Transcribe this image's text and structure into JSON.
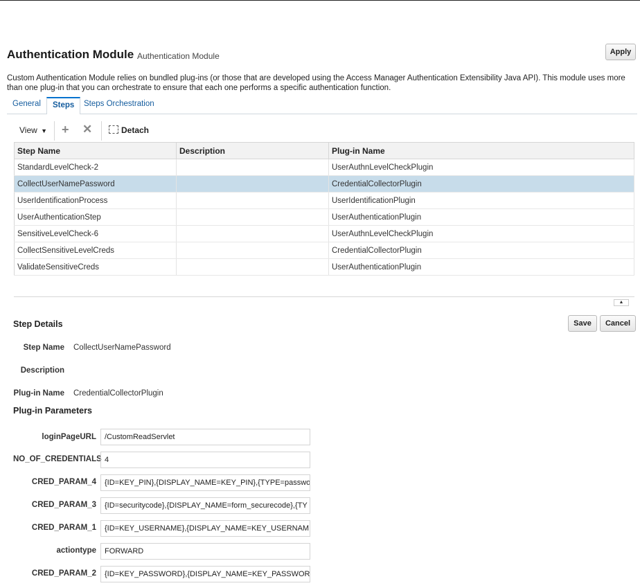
{
  "header": {
    "title": "Authentication Module",
    "subtitle": "Authentication Module",
    "apply_label": "Apply",
    "description": "Custom Authentication Module relies on bundled plug-ins (or those that are developed using the Access Manager Authentication Extensibility Java API). This module uses more than one plug-in that you can orchestrate to ensure that each one performs a specific authentication function."
  },
  "tabs": [
    {
      "label": "General"
    },
    {
      "label": "Steps"
    },
    {
      "label": "Steps Orchestration"
    }
  ],
  "toolbar": {
    "view_label": "View",
    "detach_label": "Detach"
  },
  "table": {
    "columns": [
      "Step Name",
      "Description",
      "Plug-in Name"
    ],
    "rows": [
      {
        "step": "StandardLevelCheck-2",
        "desc": "",
        "plugin": "UserAuthnLevelCheckPlugin"
      },
      {
        "step": "CollectUserNamePassword",
        "desc": "",
        "plugin": "CredentialCollectorPlugin"
      },
      {
        "step": "UserIdentificationProcess",
        "desc": "",
        "plugin": "UserIdentificationPlugin"
      },
      {
        "step": "UserAuthenticationStep",
        "desc": "",
        "plugin": "UserAuthenticationPlugin"
      },
      {
        "step": "SensitiveLevelCheck-6",
        "desc": "",
        "plugin": "UserAuthnLevelCheckPlugin"
      },
      {
        "step": "CollectSensitiveLevelCreds",
        "desc": "",
        "plugin": "CredentialCollectorPlugin"
      },
      {
        "step": "ValidateSensitiveCreds",
        "desc": "",
        "plugin": "UserAuthenticationPlugin"
      }
    ]
  },
  "step_details": {
    "heading": "Step Details",
    "save_label": "Save",
    "cancel_label": "Cancel",
    "step_name_label": "Step Name",
    "step_name_value": "CollectUserNamePassword",
    "description_label": "Description",
    "description_value": "",
    "plugin_name_label": "Plug-in Name",
    "plugin_name_value": "CredentialCollectorPlugin"
  },
  "plugin_params": {
    "heading": "Plug-in Parameters",
    "params": [
      {
        "label": "loginPageURL",
        "value": "/CustomReadServlet"
      },
      {
        "label": "NO_OF_CREDENTIALS",
        "value": "4"
      },
      {
        "label": "CRED_PARAM_4",
        "value": "{ID=KEY_PIN},{DISPLAY_NAME=KEY_PIN},{TYPE=passwo"
      },
      {
        "label": "CRED_PARAM_3",
        "value": "{ID=securitycode},{DISPLAY_NAME=form_securecode},{TY"
      },
      {
        "label": "CRED_PARAM_1",
        "value": "{ID=KEY_USERNAME},{DISPLAY_NAME=KEY_USERNAME"
      },
      {
        "label": "actiontype",
        "value": "FORWARD"
      },
      {
        "label": "CRED_PARAM_2",
        "value": "{ID=KEY_PASSWORD},{DISPLAY_NAME=KEY_PASSWORD"
      }
    ]
  }
}
